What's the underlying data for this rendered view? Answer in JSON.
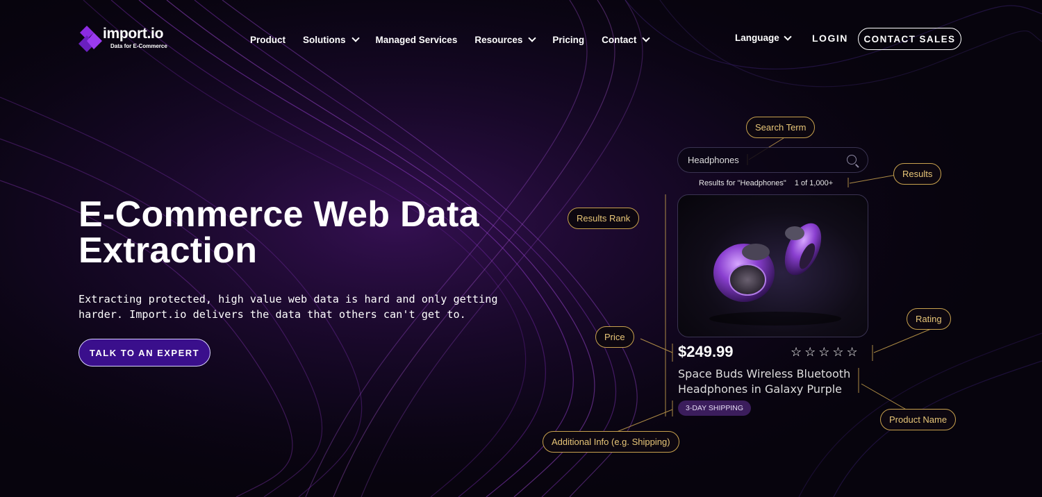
{
  "brand": {
    "name": "import.io",
    "tagline": "Data for E-Commerce",
    "accent": "#8b2be2"
  },
  "nav": {
    "items": [
      {
        "label": "Product",
        "dropdown": false
      },
      {
        "label": "Solutions",
        "dropdown": true
      },
      {
        "label": "Managed Services",
        "dropdown": false
      },
      {
        "label": "Resources",
        "dropdown": true
      },
      {
        "label": "Pricing",
        "dropdown": false
      },
      {
        "label": "Contact",
        "dropdown": true
      }
    ],
    "language": "Language",
    "login": "LOGIN",
    "contact_sales": "CONTACT SALES"
  },
  "hero": {
    "title": "E-Commerce Web Data Extraction",
    "subtitle": "Extracting protected, high value web data is hard and only getting harder. Import.io delivers the data that others can't get to.",
    "cta": "TALK TO AN EXPERT"
  },
  "mock": {
    "search_value": "Headphones",
    "results_text": "Results for \"Headphones\"",
    "results_count": "1 of 1,000+",
    "price": "$249.99",
    "rating_stars": "☆☆☆☆☆",
    "product_name": "Space Buds Wireless Bluetooth Headphones in Galaxy Purple",
    "shipping_badge": "3-DAY SHIPPING"
  },
  "annotations": {
    "search_term": "Search Term",
    "results": "Results",
    "results_rank": "Results Rank",
    "rating": "Rating",
    "price": "Price",
    "product_name": "Product Name",
    "additional_info": "Additional Info (e.g. Shipping)"
  },
  "colors": {
    "annotation_gold": "#c9a24e",
    "cta_bg": "#3a0f8c",
    "background": "#07040d"
  }
}
